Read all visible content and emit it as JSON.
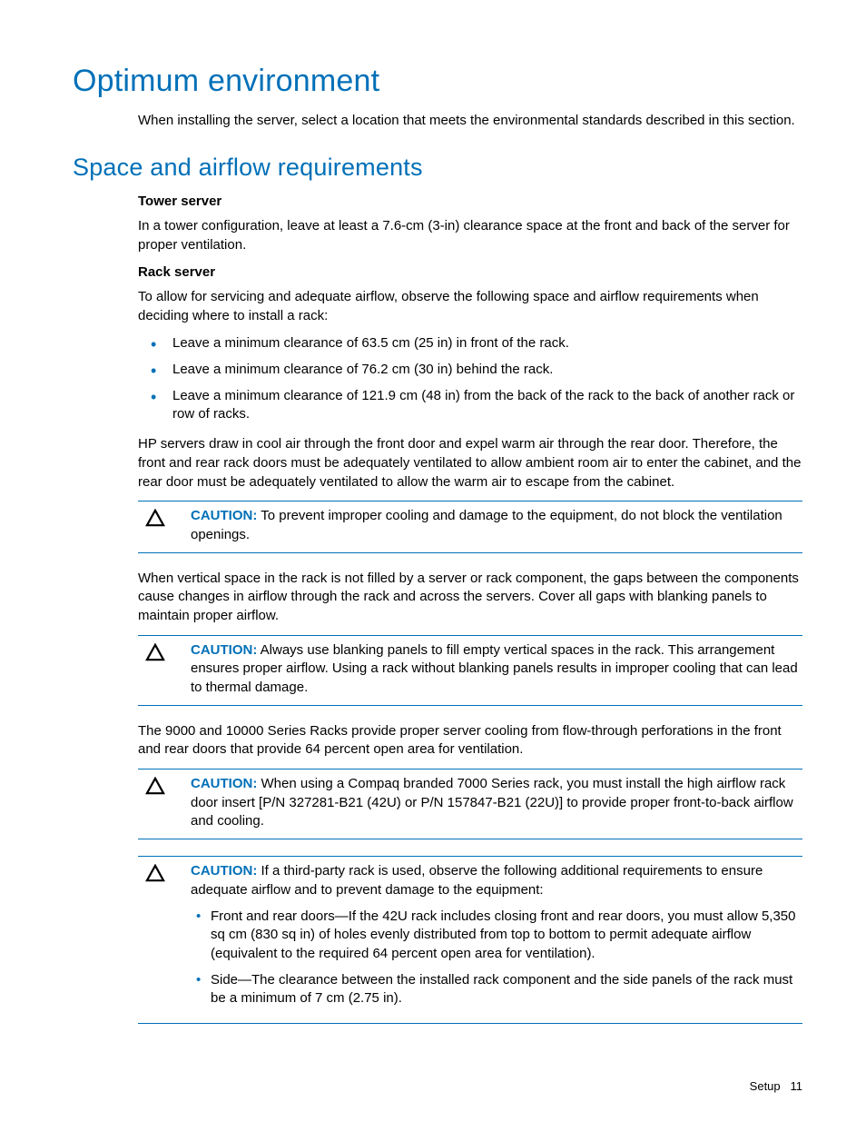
{
  "h1": "Optimum environment",
  "intro": "When installing the server, select a location that meets the environmental standards described in this section.",
  "h2": "Space and airflow requirements",
  "tower": {
    "heading": "Tower server",
    "text": "In a tower configuration, leave at least a 7.6-cm (3-in) clearance space at the front and back of the server for proper ventilation."
  },
  "rack": {
    "heading": "Rack server",
    "lead": "To allow for servicing and adequate airflow, observe the following space and airflow requirements when deciding where to install a rack:",
    "bullets": [
      "Leave a minimum clearance of 63.5 cm (25 in) in front of the rack.",
      "Leave a minimum clearance of 76.2 cm (30 in) behind the rack.",
      "Leave a minimum clearance of 121.9 cm (48 in) from the back of the rack to the back of another rack or row of racks."
    ],
    "para1": "HP servers draw in cool air through the front door and expel warm air through the rear door. Therefore, the front and rear rack doors must be adequately ventilated to allow ambient room air to enter the cabinet, and the rear door must be adequately ventilated to allow the warm air to escape from the cabinet."
  },
  "caution_label": "CAUTION:",
  "caution1": "To prevent improper cooling and damage to the equipment, do not block the ventilation openings.",
  "para2": "When vertical space in the rack is not filled by a server or rack component, the gaps between the components cause changes in airflow through the rack and across the servers. Cover all gaps with blanking panels to maintain proper airflow.",
  "caution2": "Always use blanking panels to fill empty vertical spaces in the rack. This arrangement ensures proper airflow. Using a rack without blanking panels results in improper cooling that can lead to thermal damage.",
  "para3": "The 9000 and 10000 Series Racks provide proper server cooling from flow-through perforations in the front and rear doors that provide 64 percent open area for ventilation.",
  "caution3": "When using a Compaq branded 7000 Series rack, you must install the high airflow rack door insert [P/N 327281-B21 (42U) or P/N 157847-B21 (22U)] to provide proper front-to-back airflow and cooling.",
  "caution4": {
    "lead": "If a third-party rack is used, observe the following additional requirements to ensure adequate airflow and to prevent damage to the equipment:",
    "items": [
      "Front and rear doors—If the 42U rack includes closing front and rear doors, you must allow 5,350 sq cm (830 sq in) of holes evenly distributed from top to bottom to permit adequate airflow (equivalent to the required 64 percent open area for ventilation).",
      "Side—The clearance between the installed rack component and the side panels of the rack must be a minimum of 7 cm (2.75 in)."
    ]
  },
  "footer": {
    "section": "Setup",
    "page": "11"
  }
}
